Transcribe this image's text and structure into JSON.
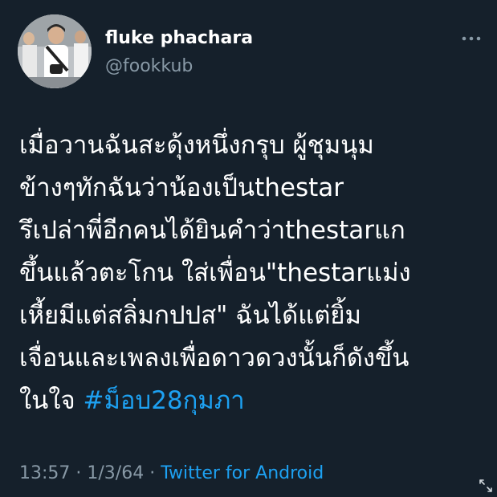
{
  "user": {
    "display_name": "fluke phachara",
    "handle": "@fookkub"
  },
  "more_icon": "more-horizontal-icon",
  "tweet": {
    "lines": [
      "เมื่อวานฉันสะดุ้งหนึ่งกรุบ ผู้ชุมนุม",
      "ข้างๆทักฉันว่าน้องเป็นthestar",
      "รึเปล่าพี่อีกคนได้ยินคำว่าthestarแก",
      "ขึ้นแล้วตะโกน ใส่เพื่อน\"thestarแม่ง",
      "เหี้ยมีแต่สลิ่มกปปส\" ฉันได้แต่ยิ้ม",
      "เจื่อนและเพลงเพื่อดาวดวงนั้นก็ดังขึ้น"
    ],
    "last_line_prefix": "ในใจ ",
    "hashtag": "#ม็อบ28กุมภา"
  },
  "meta": {
    "time": "13:57",
    "date": "1/3/64",
    "separator": " · ",
    "source": "Twitter for Android"
  },
  "colors": {
    "background": "#15202b",
    "text": "#ffffff",
    "secondary": "#8899a6",
    "accent": "#1da1f2"
  },
  "expand_icon": "expand-icon"
}
